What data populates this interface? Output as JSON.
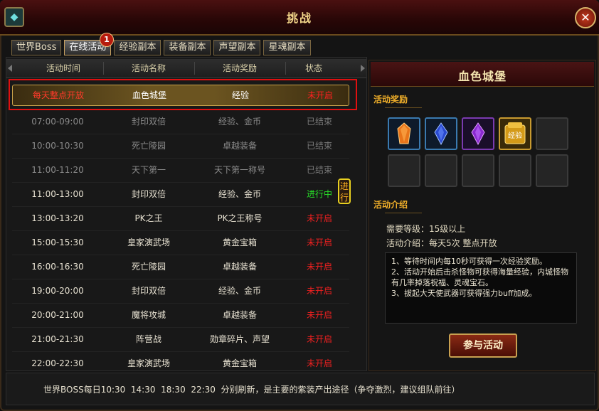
{
  "window": {
    "title": "挑战"
  },
  "tabs": [
    {
      "label": "世界Boss"
    },
    {
      "label": "在线活动"
    },
    {
      "label": "经验副本"
    },
    {
      "label": "装备副本"
    },
    {
      "label": "声望副本"
    },
    {
      "label": "星魂副本"
    }
  ],
  "tab_badge": "1",
  "table": {
    "headers": [
      "活动时间",
      "活动名称",
      "活动奖励",
      "状态"
    ],
    "highlight": {
      "time": "每天整点开放",
      "name": "血色城堡",
      "reward": "经验",
      "status": "未开启"
    },
    "rows": [
      {
        "time": "07:00-09:00",
        "name": "封印双倍",
        "reward": "经验、金币",
        "status": "已结束"
      },
      {
        "time": "10:00-10:30",
        "name": "死亡陵园",
        "reward": "卓越装备",
        "status": "已结束"
      },
      {
        "time": "11:00-11:20",
        "name": "天下第一",
        "reward": "天下第一称号",
        "status": "已结束"
      },
      {
        "time": "11:00-13:00",
        "name": "封印双倍",
        "reward": "经验、金币",
        "status": "进行中"
      },
      {
        "time": "13:00-13:20",
        "name": "PK之王",
        "reward": "PK之王称号",
        "status": "未开启"
      },
      {
        "time": "15:00-15:30",
        "name": "皇家演武场",
        "reward": "黄金宝箱",
        "status": "未开启"
      },
      {
        "time": "16:00-16:30",
        "name": "死亡陵园",
        "reward": "卓越装备",
        "status": "未开启"
      },
      {
        "time": "19:00-20:00",
        "name": "封印双倍",
        "reward": "经验、金币",
        "status": "未开启"
      },
      {
        "time": "20:00-21:00",
        "name": "魔将攻城",
        "reward": "卓越装备",
        "status": "未开启"
      },
      {
        "time": "21:00-21:30",
        "name": "阵营战",
        "reward": "勋章碎片、声望",
        "status": "未开启"
      },
      {
        "time": "22:00-22:30",
        "name": "皇家演武场",
        "reward": "黄金宝箱",
        "status": "未开启"
      }
    ],
    "go_button": "进行"
  },
  "detail": {
    "title": "血色城堡",
    "rewards_label": "活动奖励",
    "reward_items": [
      "orange-gem-icon",
      "blue-gem-icon",
      "purple-gem-icon",
      "exp-icon"
    ],
    "exp_icon_label": "经验",
    "intro_label": "活动介绍",
    "level_req": "需要等级：15级以上",
    "intro_line": "活动介绍：每天5次  整点开放",
    "description": [
      "1、等待时间内每10秒可获得一次经验奖励。",
      "2、活动开始后击杀怪物可获得海量经验，内城怪物有几率掉落祝福、灵魂宝石。",
      "3、拔起大天使武器可获得强力buff加成。"
    ],
    "join_button": "参与活动"
  },
  "footer": {
    "text": "世界BOSS每日10:30  14:30  18:30  22:30  分别刷新，是主要的紫装产出途径（争夺激烈，建议组队前往）"
  },
  "colors": {
    "status_pending": "#f02020",
    "status_active": "#28e028",
    "status_ended": "#7a7a7a",
    "accent_gold": "#f2b02a"
  }
}
